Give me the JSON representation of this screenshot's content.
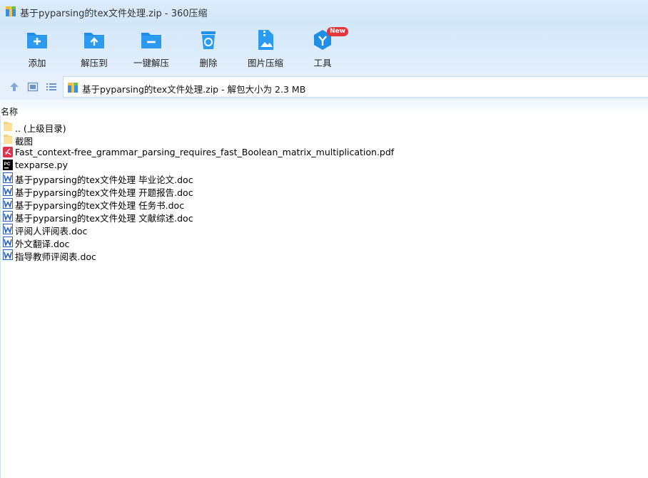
{
  "window": {
    "title": "基于pyparsing的tex文件处理.zip - 360压缩"
  },
  "colors": {
    "accent": "#1e8ee6",
    "pdf": "#e0334b",
    "word": "#2b5fbd",
    "folder": "#f7d27a",
    "badge": "#e8353b"
  },
  "toolbar": {
    "items": [
      {
        "label": "添加",
        "icon": "add-icon"
      },
      {
        "label": "解压到",
        "icon": "extract-to-icon"
      },
      {
        "label": "一键解压",
        "icon": "one-click-extract-icon"
      },
      {
        "label": "删除",
        "icon": "delete-icon"
      },
      {
        "label": "图片压缩",
        "icon": "image-compress-icon"
      },
      {
        "label": "工具",
        "icon": "tools-icon",
        "badge": "New"
      }
    ]
  },
  "nav": {
    "path": "基于pyparsing的tex文件处理.zip - 解包大小为 2.3 MB"
  },
  "list": {
    "column_name": "名称",
    "files": [
      {
        "name": ".. (上级目录)",
        "type": "folder"
      },
      {
        "name": "截图",
        "type": "folder"
      },
      {
        "name": "Fast_context-free_grammar_parsing_requires_fast_Boolean_matrix_multiplication.pdf",
        "type": "pdf"
      },
      {
        "name": "texparse.py",
        "type": "py"
      },
      {
        "name": "基于pyparsing的tex文件处理 毕业论文.doc",
        "type": "doc"
      },
      {
        "name": "基于pyparsing的tex文件处理 开题报告.doc",
        "type": "doc"
      },
      {
        "name": "基于pyparsing的tex文件处理 任务书.doc",
        "type": "doc"
      },
      {
        "name": "基于pyparsing的tex文件处理 文献综述.doc",
        "type": "doc"
      },
      {
        "name": "评阅人评阅表.doc",
        "type": "doc"
      },
      {
        "name": "外文翻译.doc",
        "type": "doc"
      },
      {
        "name": "指导教师评阅表.doc",
        "type": "doc"
      }
    ]
  }
}
